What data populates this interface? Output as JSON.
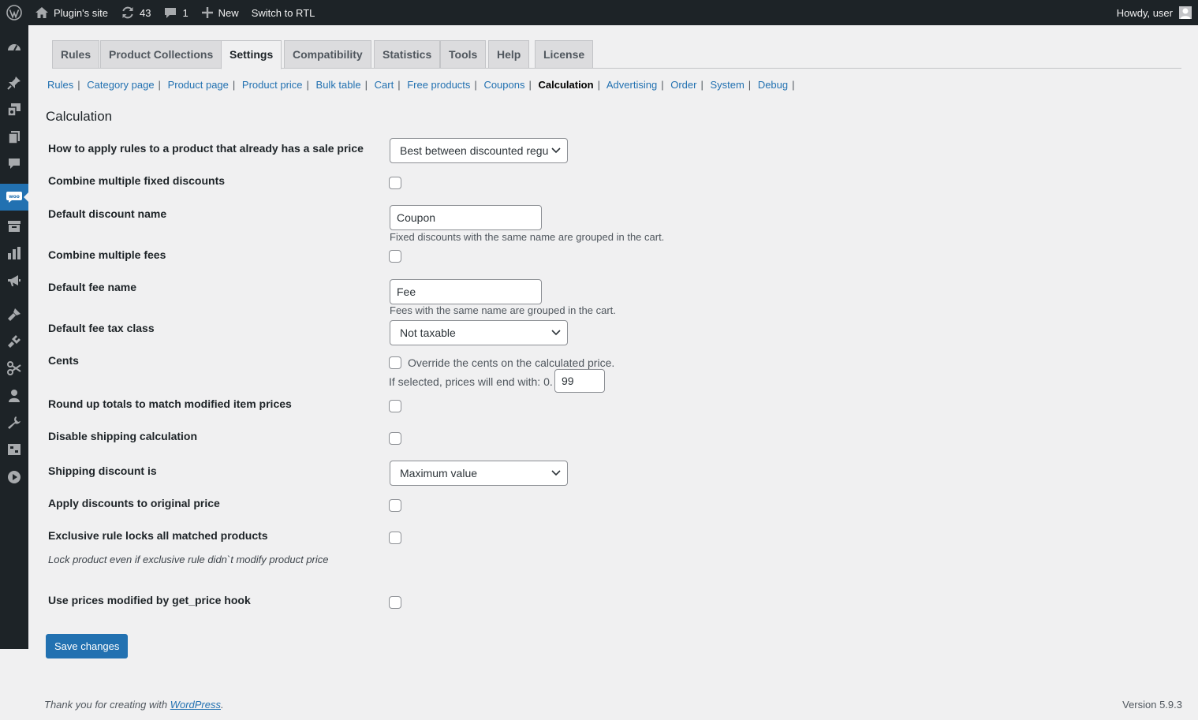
{
  "admin_bar": {
    "site_name": "Plugin's site",
    "updates_count": "43",
    "comments_count": "1",
    "new_label": "New",
    "rtl_label": "Switch to RTL",
    "greeting": "Howdy, user"
  },
  "side_menu": {
    "icons": [
      "dashboard-icon",
      "pin-icon",
      "media-icon",
      "pages-icon",
      "comments-icon",
      "woocommerce-icon",
      "products-icon",
      "analytics-icon",
      "marketing-icon",
      "appearance-icon",
      "plugins-icon",
      "scissors-icon",
      "users-icon",
      "tools-icon",
      "settings-icon",
      "play-icon"
    ],
    "current": "woocommerce-icon"
  },
  "tabs": [
    {
      "label": "Rules"
    },
    {
      "label": "Product Collections"
    },
    {
      "label": "Settings",
      "active": true
    },
    {
      "label": "Compatibility"
    },
    {
      "label": "Statistics"
    },
    {
      "label": "Tools"
    },
    {
      "label": "Help"
    },
    {
      "label": "License"
    }
  ],
  "subnav": [
    {
      "label": "Rules"
    },
    {
      "label": "Category page"
    },
    {
      "label": "Product page"
    },
    {
      "label": "Product price"
    },
    {
      "label": "Bulk table"
    },
    {
      "label": "Cart"
    },
    {
      "label": "Free products"
    },
    {
      "label": "Coupons"
    },
    {
      "label": "Calculation",
      "current": true
    },
    {
      "label": "Advertising"
    },
    {
      "label": "Order"
    },
    {
      "label": "System"
    },
    {
      "label": "Debug"
    }
  ],
  "page_title": "Calculation",
  "settings": {
    "sale_price": {
      "label": "How to apply rules to a product that already has a sale price",
      "value": "Best between discounted regu"
    },
    "combine_fixed": {
      "label": "Combine multiple fixed discounts",
      "checked": false
    },
    "discount_name": {
      "label": "Default discount name",
      "value": "Coupon",
      "description": "Fixed discounts with the same name are grouped in the cart."
    },
    "combine_fees": {
      "label": "Combine multiple fees",
      "checked": false
    },
    "fee_name": {
      "label": "Default fee name",
      "value": "Fee",
      "description": "Fees with the same name are grouped in the cart."
    },
    "fee_tax_class": {
      "label": "Default fee tax class",
      "value": "Not taxable"
    },
    "cents": {
      "label": "Cents",
      "checkbox_label": "Override the cents on the calculated price.",
      "checked": false,
      "end_label": "If selected, prices will end with: 0.",
      "value": "99"
    },
    "round_up": {
      "label": "Round up totals to match modified item prices",
      "checked": false
    },
    "disable_shipping": {
      "label": "Disable shipping calculation",
      "checked": false
    },
    "shipping_discount": {
      "label": "Shipping discount is",
      "value": "Maximum value"
    },
    "apply_original": {
      "label": "Apply discounts to original price",
      "checked": false
    },
    "exclusive_lock": {
      "label": "Exclusive rule locks all matched products",
      "description": "Lock product even if exclusive rule didn`t modify product price",
      "checked": false
    },
    "get_price_hook": {
      "label": "Use prices modified by get_price hook",
      "checked": false
    }
  },
  "save_button": "Save changes",
  "footer": {
    "thanks_prefix": "Thank you for creating with ",
    "wordpress_link": "WordPress",
    "thanks_suffix": ".",
    "version": "Version 5.9.3"
  },
  "colors": {
    "adminbar_bg": "#1d2327",
    "accent": "#2271b1",
    "page_bg": "#f0f0f1"
  }
}
